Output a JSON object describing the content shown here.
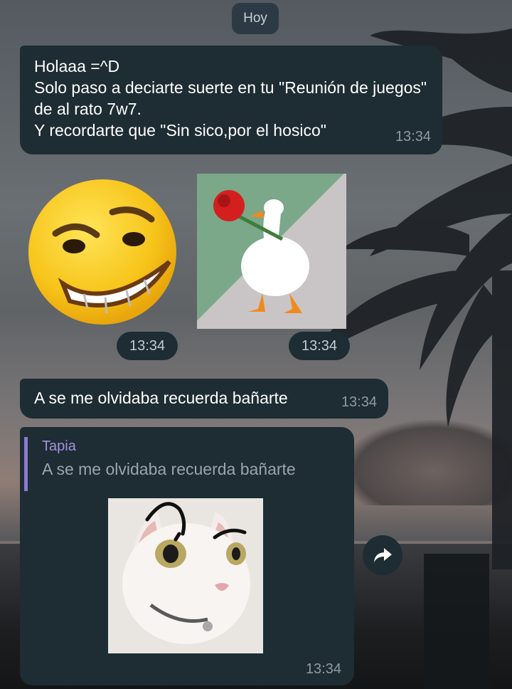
{
  "chat": {
    "date_label": "Hoy",
    "messages": [
      {
        "type": "text",
        "text": "Holaaa =^D\nSolo paso a deciarte suerte en tu \"Reunión de juegos\" de al rato 7w7.\nY recordarte que \"Sin sico,por el hosico\"",
        "time": "13:34"
      },
      {
        "type": "sticker",
        "sticker": "grinning-emoji-sticker",
        "time": "13:34"
      },
      {
        "type": "sticker",
        "sticker": "goose-with-rose-sticker",
        "time": "13:34"
      },
      {
        "type": "text",
        "text": "A se me olvidaba recuerda bañarte",
        "time": "13:34"
      },
      {
        "type": "reply-photo",
        "reply_author": "Tapia",
        "reply_text": "A se me olvidaba recuerda bañarte",
        "photo": "cat-with-drawn-eyebrows-photo",
        "time": "13:34"
      }
    ]
  },
  "icons": {
    "forward": "forward-arrow-icon"
  },
  "colors": {
    "bubble": "#1e2c33",
    "reply_accent": "#8b7ad0",
    "reply_name": "#a191e0",
    "time_text": "#8f9ba3"
  }
}
